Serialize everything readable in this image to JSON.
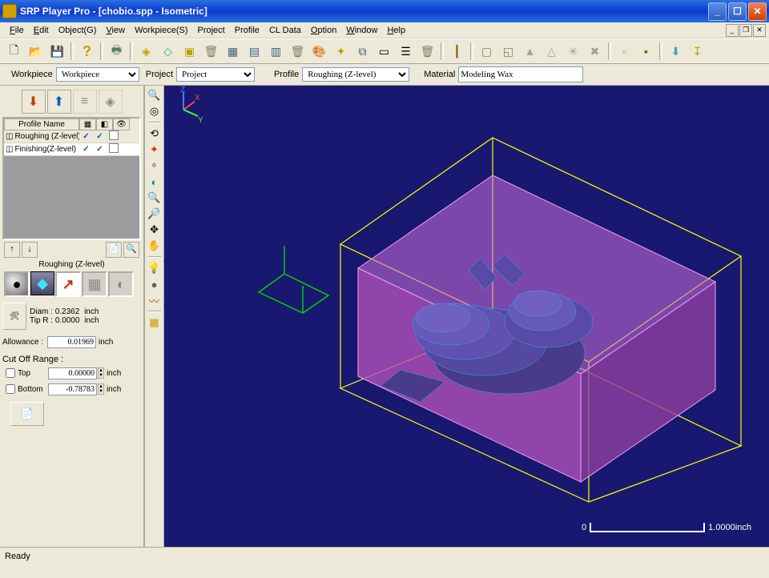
{
  "title": "SRP Player Pro - [chobio.spp - Isometric]",
  "menu": {
    "file": "File",
    "edit": "Edit",
    "object": "Object(G)",
    "view": "View",
    "workpiece": "Workpiece(S)",
    "project": "Project",
    "profile": "Profile",
    "cldata": "CL Data",
    "option": "Option",
    "window": "Window",
    "help": "Help"
  },
  "selectors": {
    "workpiece_label": "Workpiece",
    "workpiece_value": "Workpiece",
    "project_label": "Project",
    "project_value": "Project",
    "profile_label": "Profile",
    "profile_value": "Roughing (Z-level)",
    "material_label": "Material",
    "material_value": "Modeling Wax"
  },
  "profile_panel": {
    "header": "Profile Name",
    "rows": [
      {
        "name": "Roughing (Z-level)",
        "c1": "✓",
        "c2": "✓",
        "selected": true
      },
      {
        "name": "Finishing(Z-level)",
        "c1": "✓",
        "c2": "✓",
        "selected": false
      }
    ],
    "current_label": "Roughing (Z-level)"
  },
  "params": {
    "diam_label": "Diam :",
    "diam_value": "0.2362",
    "diam_unit": "inch",
    "tipr_label": "Tip R :",
    "tipr_value": "0.0000",
    "tipr_unit": "inch",
    "allow_label": "Allowance :",
    "allow_value": "0.01969",
    "allow_unit": "inch",
    "cutoff_label": "Cut Off Range :",
    "top_label": "Top",
    "top_value": "0.00000",
    "top_unit": "inch",
    "bottom_label": "Bottom",
    "bottom_value": "-0.78783",
    "bottom_unit": "inch"
  },
  "scale": {
    "left": "0",
    "right": "1.0000inch"
  },
  "axis": {
    "x": "X",
    "y": "Y",
    "z": "Z"
  },
  "status": "Ready",
  "icons": {
    "new": "🗋",
    "open": "📂",
    "save": "💾",
    "help": "?",
    "print": "🖶",
    "cube1": "◈",
    "cube2": "◇",
    "cube3": "▣",
    "del": "🗑",
    "win1": "▦",
    "win2": "▤",
    "win3": "▥",
    "trash": "🗑",
    "pal": "🎨",
    "star": "✦",
    "copy": "⧉",
    "page": "▭",
    "layers": "☰",
    "drill": "┃",
    "box": "▢",
    "sel": "◱",
    "t1": "▲",
    "t2": "△",
    "gear1": "✳",
    "x": "✖",
    "sq1": "▫",
    "sq2": "▪",
    "dl": "⬇",
    "up": "↧",
    "big1": "⬇",
    "big2": "⬆",
    "arrow_up": "↑",
    "arrow_dn": "↓",
    "rail": [
      "🔍",
      "◎",
      "",
      "⟲",
      "✦",
      "⚬",
      "◐",
      "🔍",
      "🔎",
      "✥",
      "✋",
      "",
      "💡",
      "●",
      "〰",
      "▦"
    ],
    "preset": [
      "●",
      "◆",
      "↗",
      "▦",
      "◐"
    ],
    "apply": "📄"
  }
}
